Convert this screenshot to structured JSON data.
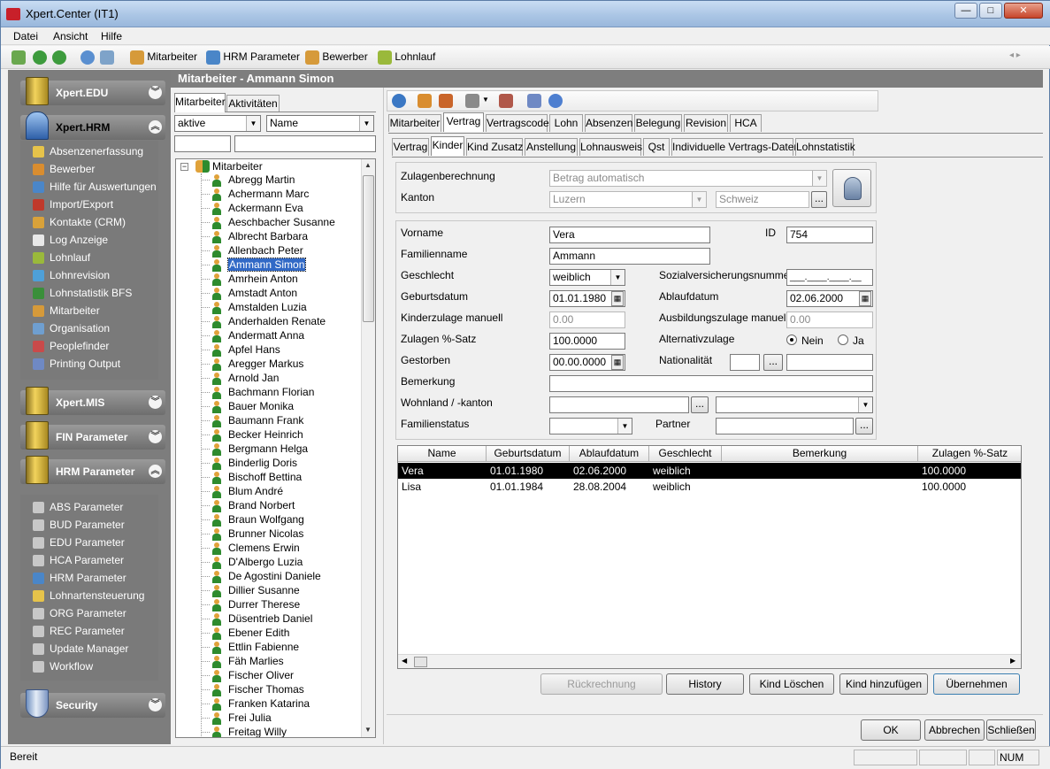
{
  "window": {
    "title": "Xpert.Center (IT1)",
    "minimize": "—",
    "maximize": "□",
    "close": "✕"
  },
  "menu": [
    "Datei",
    "Ansicht",
    "Hilfe"
  ],
  "toolbar": {
    "items": [
      "Mitarbeiter",
      "HRM Parameter",
      "Bewerber",
      "Lohnlauf"
    ]
  },
  "nav": {
    "groups": [
      {
        "label": "Xpert.EDU",
        "state": "collapsed"
      },
      {
        "label": "Xpert.HRM",
        "state": "expanded"
      },
      {
        "label": "Xpert.MIS",
        "state": "collapsed"
      },
      {
        "label": "FIN Parameter",
        "state": "collapsed"
      },
      {
        "label": "HRM Parameter",
        "state": "expanded"
      },
      {
        "label": "Security",
        "state": "collapsed"
      }
    ],
    "hrm_items": [
      "Absenzenerfassung",
      "Bewerber",
      "Hilfe für Auswertungen",
      "Import/Export",
      "Kontakte (CRM)",
      "Log Anzeige",
      "Lohnlauf",
      "Lohnrevision",
      "Lohnstatistik BFS",
      "Mitarbeiter",
      "Organisation",
      "Peoplefinder",
      "Printing Output"
    ],
    "param_items": [
      "ABS Parameter",
      "BUD Parameter",
      "EDU Parameter",
      "HCA Parameter",
      "HRM Parameter",
      "Lohnartensteuerung",
      "ORG Parameter",
      "REC Parameter",
      "Update Manager",
      "Workflow"
    ]
  },
  "heading": "Mitarbeiter - Ammann Simon",
  "list": {
    "tabs": [
      "Mitarbeiter",
      "Aktivitäten"
    ],
    "filter_status": "aktive",
    "filter_sort": "Name",
    "root": "Mitarbeiter",
    "selected": "Ammann Simon",
    "employees": [
      "Abregg Martin",
      "Achermann Marc",
      "Ackermann Eva",
      "Aeschbacher Susanne",
      "Albrecht Barbara",
      "Allenbach Peter",
      "Ammann Simon",
      "Amrhein Anton",
      "Amstadt Anton",
      "Amstalden Luzia",
      "Anderhalden Renate",
      "Andermatt Anna",
      "Apfel Hans",
      "Aregger Markus",
      "Arnold Jan",
      "Bachmann Florian",
      "Bauer Monika",
      "Baumann Frank",
      "Becker Heinrich",
      "Bergmann Helga",
      "Binderlig Doris",
      "Bischoff Bettina",
      "Blum André",
      "Brand Norbert",
      "Braun Wolfgang",
      "Brunner Nicolas",
      "Clemens Erwin",
      "D'Albergo Luzia",
      "De Agostini Daniele",
      "Dillier Susanne",
      "Durrer Therese",
      "Düsentrieb Daniel",
      "Ebener Edith",
      "Ettlin Fabienne",
      "Fäh Marlies",
      "Fischer Oliver",
      "Fischer Thomas",
      "Franken Katarina",
      "Frei Julia",
      "Freitag Willy"
    ]
  },
  "detail": {
    "tabs1": [
      "Mitarbeiter",
      "Vertrag",
      "Vertragscode",
      "Lohn",
      "Absenzen",
      "Belegung",
      "Revision",
      "HCA"
    ],
    "tabs1_selected": "Vertrag",
    "tabs2": [
      "Vertrag",
      "Kinder",
      "Kind Zusatz",
      "Anstellung",
      "Lohnausweis",
      "Qst",
      "Individuelle Vertrags-Daten",
      "Lohnstatistik"
    ],
    "tabs2_selected": "Kinder",
    "zulagenberechnung_label": "Zulagenberechnung",
    "zulagenberechnung_value": "Betrag automatisch",
    "kanton_label": "Kanton",
    "kanton_value": "Luzern",
    "land_value": "Schweiz",
    "vorname_label": "Vorname",
    "vorname": "Vera",
    "id_label": "ID",
    "id": "754",
    "familienname_label": "Familienname",
    "familienname": "Ammann",
    "geschlecht_label": "Geschlecht",
    "geschlecht": "weiblich",
    "sozialversicherungsnummer_label": "Sozialversicherungsnummer",
    "sozialversicherungsnummer": "___.____.____.__",
    "geburtsdatum_label": "Geburtsdatum",
    "geburtsdatum": "01.01.1980",
    "ablaufdatum_label": "Ablaufdatum",
    "ablaufdatum": "02.06.2000",
    "kinderzulage_label": "Kinderzulage manuell",
    "kinderzulage": "0.00",
    "ausbildungszulage_label": "Ausbildungszulage manuell",
    "ausbildungszulage": "0.00",
    "zulagen_satz_label": "Zulagen %-Satz",
    "zulagen_satz": "100.0000",
    "alternativzulage_label": "Alternativzulage",
    "alternativ_options": [
      "Nein",
      "Ja"
    ],
    "alternativ_selected": "Nein",
    "gestorben_label": "Gestorben",
    "gestorben": "00.00.0000",
    "nationalitaet_label": "Nationalität",
    "bemerkung_label": "Bemerkung",
    "wohnland_label": "Wohnland / -kanton",
    "familienstatus_label": "Familienstatus",
    "partner_label": "Partner",
    "ellipsis": "..."
  },
  "grid": {
    "columns": [
      "Name",
      "Geburtsdatum",
      "Ablaufdatum",
      "Geschlecht",
      "Bemerkung",
      "Zulagen %-Satz"
    ],
    "rows": [
      [
        "Vera",
        "01.01.1980",
        "02.06.2000",
        "weiblich",
        "",
        "100.0000"
      ],
      [
        "Lisa",
        "01.01.1984",
        "28.08.2004",
        "weiblich",
        "",
        "100.0000"
      ]
    ]
  },
  "buttons": {
    "rueckrechnung": "Rückrechnung",
    "history": "History",
    "kind_loeschen": "Kind Löschen",
    "kind_hinzufuegen": "Kind hinzufügen",
    "uebernehmen": "Übernehmen",
    "ok": "OK",
    "abbrechen": "Abbrechen",
    "schliessen": "Schließen"
  },
  "status": {
    "text": "Bereit",
    "num": "NUM"
  },
  "colors": {
    "selection": "#3169c6",
    "header_gray": "#7e7e7e",
    "nav_gray": "#7d7d7d"
  }
}
